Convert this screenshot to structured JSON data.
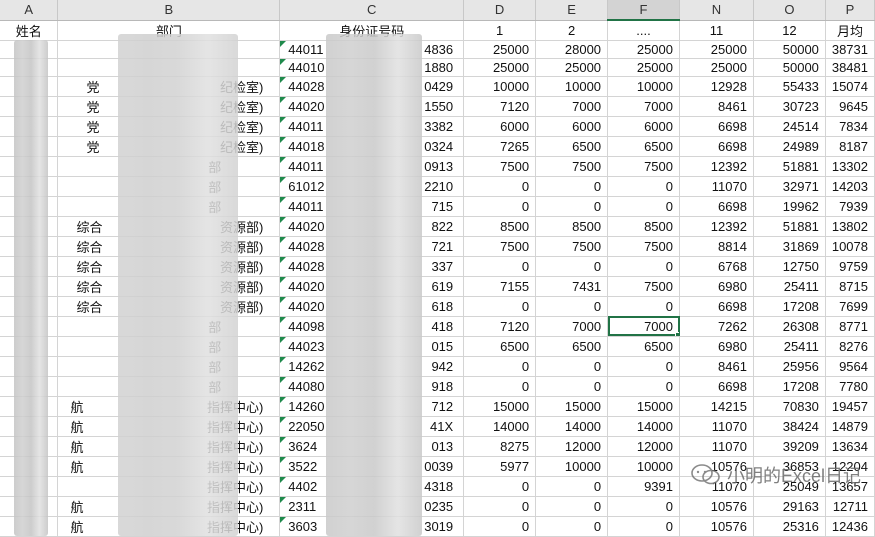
{
  "column_headers": [
    "A",
    "B",
    "C",
    "D",
    "E",
    "F",
    "N",
    "O",
    "P"
  ],
  "selected_column": "F",
  "header_row": {
    "name": "姓名",
    "dept": "部门",
    "id": "身份证号码",
    "m1": "1",
    "m2": "2",
    "mid": "....",
    "m11": "11",
    "m12": "12",
    "avg": "月均"
  },
  "rows": [
    {
      "name": "",
      "dept": "",
      "id": "44011",
      "id_end": "4836",
      "m1": "25000",
      "m2": "28000",
      "mid": "25000",
      "m11": "25000",
      "m12": "50000",
      "avg": "38731"
    },
    {
      "name": "",
      "dept": "",
      "id": "44010",
      "id_end": "1880",
      "m1": "25000",
      "m2": "25000",
      "mid": "25000",
      "m11": "25000",
      "m12": "50000",
      "avg": "38481"
    },
    {
      "name": "",
      "dept": "党",
      "dept_end": "纪检室)",
      "id": "44028",
      "id_end": "0429",
      "m1": "10000",
      "m2": "10000",
      "mid": "10000",
      "m11": "12928",
      "m12": "55433",
      "avg": "15074"
    },
    {
      "name": "",
      "dept": "党",
      "dept_end": "纪检室)",
      "id": "44020",
      "id_end": "1550",
      "m1": "7120",
      "m2": "7000",
      "mid": "7000",
      "m11": "8461",
      "m12": "30723",
      "avg": "9645"
    },
    {
      "name": "",
      "dept": "党",
      "dept_end": "纪检室)",
      "id": "44011",
      "id_end": "3382",
      "m1": "6000",
      "m2": "6000",
      "mid": "6000",
      "m11": "6698",
      "m12": "24514",
      "avg": "7834"
    },
    {
      "name": "",
      "dept": "党",
      "dept_end": "纪检室)",
      "id": "44018",
      "id_end": "0324",
      "m1": "7265",
      "m2": "6500",
      "mid": "6500",
      "m11": "6698",
      "m12": "24989",
      "avg": "8187"
    },
    {
      "name": "",
      "dept": "",
      "dept_end": "部",
      "id": "44011",
      "id_end": "0913",
      "m1": "7500",
      "m2": "7500",
      "mid": "7500",
      "m11": "12392",
      "m12": "51881",
      "avg": "13302"
    },
    {
      "name": "",
      "dept": "",
      "dept_end": "部",
      "id": "61012",
      "id_end": "2210",
      "m1": "0",
      "m2": "0",
      "mid": "0",
      "m11": "11070",
      "m12": "32971",
      "avg": "14203"
    },
    {
      "name": "",
      "dept": "",
      "dept_end": "部",
      "id": "44011",
      "id_end": "715",
      "m1": "0",
      "m2": "0",
      "mid": "0",
      "m11": "6698",
      "m12": "19962",
      "avg": "7939"
    },
    {
      "name": "",
      "dept": "综合",
      "dept_end": "资源部)",
      "id": "44020",
      "id_end": "822",
      "m1": "8500",
      "m2": "8500",
      "mid": "8500",
      "m11": "12392",
      "m12": "51881",
      "avg": "13802"
    },
    {
      "name": "",
      "dept": "综合",
      "dept_end": "资源部)",
      "id": "44028",
      "id_end": "721",
      "m1": "7500",
      "m2": "7500",
      "mid": "7500",
      "m11": "8814",
      "m12": "31869",
      "avg": "10078"
    },
    {
      "name": "",
      "dept": "综合",
      "dept_end": "资源部)",
      "id": "44028",
      "id_end": "337",
      "m1": "0",
      "m2": "0",
      "mid": "0",
      "m11": "6768",
      "m12": "12750",
      "avg": "9759"
    },
    {
      "name": "",
      "dept": "综合",
      "dept_end": "资源部)",
      "id": "44020",
      "id_end": "619",
      "m1": "7155",
      "m2": "7431",
      "mid": "7500",
      "m11": "6980",
      "m12": "25411",
      "avg": "8715"
    },
    {
      "name": "",
      "dept": "综合",
      "dept_end": "资源部)",
      "id": "44020",
      "id_end": "618",
      "m1": "0",
      "m2": "0",
      "mid": "0",
      "m11": "6698",
      "m12": "17208",
      "avg": "7699"
    },
    {
      "name": "",
      "dept": "",
      "dept_end": "部",
      "id": "44098",
      "id_end": "418",
      "m1": "7120",
      "m2": "7000",
      "mid": "7000",
      "m11": "7262",
      "m12": "26308",
      "avg": "8771"
    },
    {
      "name": "",
      "dept": "",
      "dept_end": "部",
      "id": "44023",
      "id_end": "015",
      "m1": "6500",
      "m2": "6500",
      "mid": "6500",
      "m11": "6980",
      "m12": "25411",
      "avg": "8276"
    },
    {
      "name": "",
      "dept": "",
      "dept_end": "部",
      "id": "14262",
      "id_end": "942",
      "m1": "0",
      "m2": "0",
      "mid": "0",
      "m11": "8461",
      "m12": "25956",
      "avg": "9564"
    },
    {
      "name": "",
      "dept": "",
      "dept_end": "部",
      "id": "44080",
      "id_end": "918",
      "m1": "0",
      "m2": "0",
      "mid": "0",
      "m11": "6698",
      "m12": "17208",
      "avg": "7780"
    },
    {
      "name": "",
      "dept": "航",
      "dept_end": "指挥中心)",
      "id": "14260",
      "id_end": "712",
      "m1": "15000",
      "m2": "15000",
      "mid": "15000",
      "m11": "14215",
      "m12": "70830",
      "avg": "19457"
    },
    {
      "name": "",
      "dept": "航",
      "dept_end": "指挥中心)",
      "id": "22050",
      "id_end": "41X",
      "m1": "14000",
      "m2": "14000",
      "mid": "14000",
      "m11": "11070",
      "m12": "38424",
      "avg": "14879"
    },
    {
      "name": "",
      "dept": "航",
      "dept_end": "指挥中心)",
      "id": "3624",
      "id_end": "013",
      "m1": "8275",
      "m2": "12000",
      "mid": "12000",
      "m11": "11070",
      "m12": "39209",
      "avg": "13634"
    },
    {
      "name": "",
      "dept": "航",
      "dept_end": "指挥中心)",
      "id": "3522",
      "id_end": "0039",
      "m1": "5977",
      "m2": "10000",
      "mid": "10000",
      "m11": "10576",
      "m12": "36853",
      "avg": "12204"
    },
    {
      "name": "",
      "dept": "",
      "dept_end": "指挥中心)",
      "id": "4402",
      "id_end": "4318",
      "m1": "0",
      "m2": "0",
      "mid": "9391",
      "m11": "11070",
      "m12": "25049",
      "avg": "13657"
    },
    {
      "name": "",
      "dept": "航",
      "dept_end": "指挥中心)",
      "id": "2311",
      "id_end": "0235",
      "m1": "0",
      "m2": "0",
      "mid": "0",
      "m11": "10576",
      "m12": "29163",
      "avg": "12711"
    },
    {
      "name": "",
      "dept": "航",
      "dept_end": "指挥中心)",
      "id": "3603",
      "id_end": "3019",
      "m1": "0",
      "m2": "0",
      "mid": "0",
      "m11": "10576",
      "m12": "25316",
      "avg": "12436"
    }
  ],
  "active_cell": {
    "row": 14,
    "column": "F",
    "value": "7000"
  },
  "watermark": "小明的Excel日记",
  "colors": {
    "accent": "#217346",
    "grid": "#d4d4d4",
    "header_bg": "#e6e6e6"
  }
}
